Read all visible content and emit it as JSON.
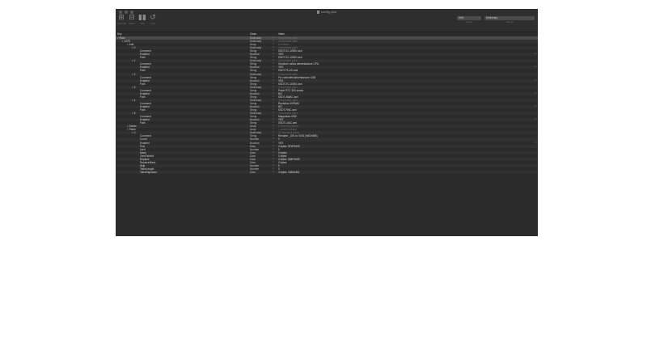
{
  "window": {
    "title": "config.plist",
    "toolbar": [
      {
        "icon": "add-icon",
        "label": "Add Child"
      },
      {
        "icon": "delete-icon",
        "label": "Delete"
      },
      {
        "icon": "view-icon",
        "label": "View"
      },
      {
        "icon": "undo-icon",
        "label": "Undo"
      }
    ],
    "format": {
      "value": "XML",
      "label": "Format"
    },
    "view_mode": {
      "value": "Dictionary",
      "label": "View As"
    }
  },
  "columns": {
    "key": "Key",
    "class": "Class",
    "value": "Value"
  },
  "rows": [
    {
      "key": "Root",
      "cls": "Dictionary",
      "val": "3 key/value pairs",
      "dim": true,
      "indent": 0,
      "tri": "▾",
      "sel": true
    },
    {
      "key": "ACPI",
      "cls": "Dictionary",
      "val": "4 key/value pairs",
      "dim": true,
      "indent": 1,
      "tri": "▾"
    },
    {
      "key": "Add",
      "cls": "Array",
      "val": "6 children",
      "dim": true,
      "indent": 2,
      "tri": "▾"
    },
    {
      "key": "0",
      "cls": "Dictionary",
      "val": "3 key/value pairs",
      "dim": true,
      "indent": 3,
      "tri": "▾"
    },
    {
      "key": "Comment",
      "cls": "String",
      "val": "SSDT-EC-USBX.aml",
      "indent": 4
    },
    {
      "key": "Enabled",
      "cls": "Boolean",
      "val": "YES",
      "indent": 4,
      "bool": true
    },
    {
      "key": "Path",
      "cls": "String",
      "val": "SSDT-EC-USBX.aml",
      "indent": 4
    },
    {
      "key": "1",
      "cls": "Dictionary",
      "val": "3 key/value pairs",
      "dim": true,
      "indent": 3,
      "tri": "▾"
    },
    {
      "key": "Comment",
      "cls": "String",
      "val": "Gestione nativa alimentazione CPU",
      "indent": 4
    },
    {
      "key": "Enabled",
      "cls": "Boolean",
      "val": "YES",
      "indent": 4,
      "bool": true
    },
    {
      "key": "Path",
      "cls": "String",
      "val": "SSDT-PLUG.aml",
      "indent": 4
    },
    {
      "key": "2",
      "cls": "Dictionary",
      "val": "3 key/value pairs",
      "dim": true,
      "indent": 3,
      "tri": "▾"
    },
    {
      "key": "Comment",
      "cls": "String",
      "val": "Fix controller/alimentazione USB",
      "indent": 4
    },
    {
      "key": "Enabled",
      "cls": "Boolean",
      "val": "YES",
      "indent": 4,
      "bool": true
    },
    {
      "key": "Path",
      "cls": "String",
      "val": "SSDT-EC-USBX.aml",
      "indent": 4
    },
    {
      "key": "3",
      "cls": "Dictionary",
      "val": "3 key/value pairs",
      "dim": true,
      "indent": 3,
      "tri": "▾"
    },
    {
      "key": "Comment",
      "cls": "String",
      "val": "Patch RTC 300 series",
      "indent": 4
    },
    {
      "key": "Enabled",
      "cls": "Boolean",
      "val": "NO",
      "indent": 4,
      "bool": true
    },
    {
      "key": "Path",
      "cls": "String",
      "val": "SSDT-AWAC.aml",
      "indent": 4
    },
    {
      "key": "4",
      "cls": "Dictionary",
      "val": "3 key/value pairs",
      "dim": true,
      "indent": 3,
      "tri": "▾"
    },
    {
      "key": "Comment",
      "cls": "String",
      "val": "Ripristino NVRAM",
      "indent": 4
    },
    {
      "key": "Enabled",
      "cls": "Boolean",
      "val": "NO",
      "indent": 4,
      "bool": true
    },
    {
      "key": "Path",
      "cls": "String",
      "val": "SSDT-PMC.aml",
      "indent": 4
    },
    {
      "key": "5",
      "cls": "Dictionary",
      "val": "3 key/value pairs",
      "dim": true,
      "indent": 3,
      "tri": "▾"
    },
    {
      "key": "Comment",
      "cls": "String",
      "val": "Mappatura USB",
      "indent": 4
    },
    {
      "key": "Enabled",
      "cls": "Boolean",
      "val": "YES",
      "indent": 4,
      "bool": true
    },
    {
      "key": "Path",
      "cls": "String",
      "val": "SSDT-UIAC.aml",
      "indent": 4
    },
    {
      "key": "Delete",
      "cls": "Array",
      "val": "0 ordered objects",
      "dim": true,
      "indent": 2,
      "tri": "▸"
    },
    {
      "key": "Patch",
      "cls": "Array",
      "val": "1 ordered object",
      "dim": true,
      "indent": 2,
      "tri": "▾"
    },
    {
      "key": "0",
      "cls": "Dictionary",
      "val": "11 key/value pairs",
      "dim": true,
      "indent": 3,
      "tri": "▾"
    },
    {
      "key": "Comment",
      "cls": "String",
      "val": "Rename _OSI to XOSI (WIDNMB)",
      "indent": 4
    },
    {
      "key": "Count",
      "cls": "Number",
      "val": "0",
      "indent": 4
    },
    {
      "key": "Enabled",
      "cls": "Boolean",
      "val": "YES",
      "indent": 4,
      "bool": true
    },
    {
      "key": "Find",
      "cls": "Data",
      "val": "4 bytes: 5F4F5349",
      "indent": 4
    },
    {
      "key": "Limit",
      "cls": "Number",
      "val": "0",
      "indent": 4
    },
    {
      "key": "Mask",
      "cls": "Data",
      "val": "0 bytes:",
      "indent": 4
    },
    {
      "key": "OemTableId",
      "cls": "Data",
      "val": "0 bytes:",
      "indent": 4
    },
    {
      "key": "Replace",
      "cls": "Data",
      "val": "4 bytes: 584F5349",
      "indent": 4
    },
    {
      "key": "ReplaceMask",
      "cls": "Data",
      "val": "0 bytes:",
      "indent": 4
    },
    {
      "key": "Skip",
      "cls": "Number",
      "val": "0",
      "indent": 4
    },
    {
      "key": "TableLength",
      "cls": "Number",
      "val": "0",
      "indent": 4
    },
    {
      "key": "TableSignature",
      "cls": "Data",
      "val": "4 bytes: 44534454",
      "indent": 4
    }
  ]
}
